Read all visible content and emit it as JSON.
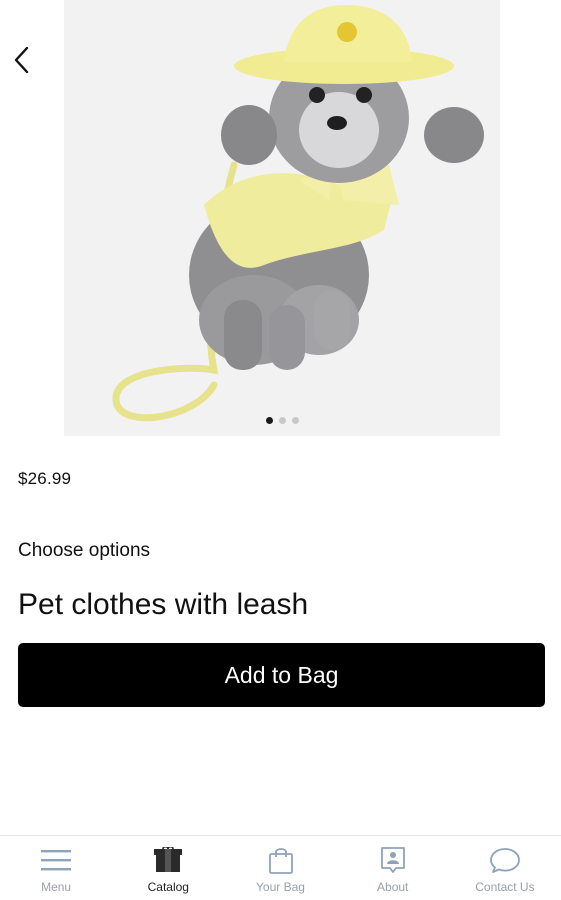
{
  "product": {
    "price": "$26.99",
    "options_label": "Choose options",
    "name": "Pet clothes with leash",
    "add_button_label": "Add to Bag",
    "gallery": {
      "total_images": 3,
      "active_index": 0
    }
  },
  "tabbar": {
    "items": [
      {
        "label": "Menu",
        "icon": "menu-icon",
        "active": false
      },
      {
        "label": "Catalog",
        "icon": "catalog-icon",
        "active": true
      },
      {
        "label": "Your Bag",
        "icon": "bag-icon",
        "active": false
      },
      {
        "label": "About",
        "icon": "about-icon",
        "active": false
      },
      {
        "label": "Contact Us",
        "icon": "chat-icon",
        "active": false
      }
    ]
  },
  "colors": {
    "accent": "#000000",
    "inactive": "#9aa0a6",
    "icon_blue_gray": "#8ea3b8"
  }
}
